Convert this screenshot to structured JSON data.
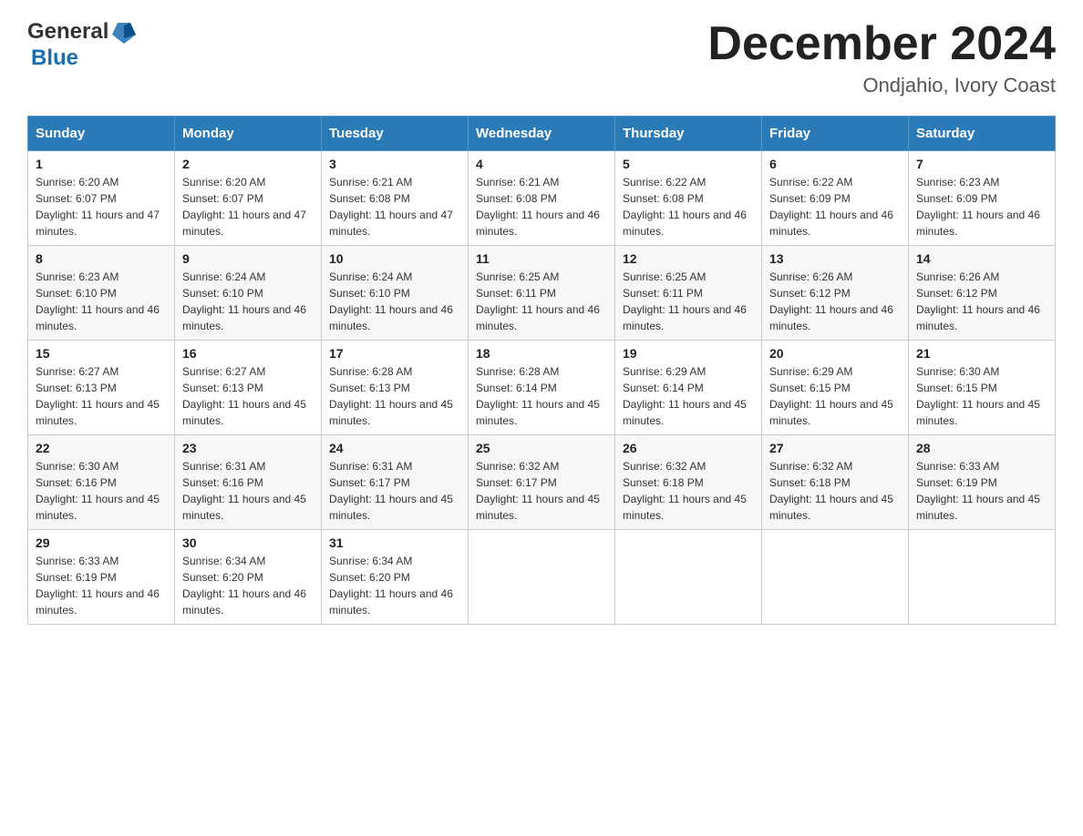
{
  "header": {
    "logo": {
      "general": "General",
      "blue": "Blue"
    },
    "title": "December 2024",
    "subtitle": "Ondjahio, Ivory Coast"
  },
  "weekdays": [
    "Sunday",
    "Monday",
    "Tuesday",
    "Wednesday",
    "Thursday",
    "Friday",
    "Saturday"
  ],
  "weeks": [
    [
      {
        "day": "1",
        "sunrise": "6:20 AM",
        "sunset": "6:07 PM",
        "daylight": "11 hours and 47 minutes."
      },
      {
        "day": "2",
        "sunrise": "6:20 AM",
        "sunset": "6:07 PM",
        "daylight": "11 hours and 47 minutes."
      },
      {
        "day": "3",
        "sunrise": "6:21 AM",
        "sunset": "6:08 PM",
        "daylight": "11 hours and 47 minutes."
      },
      {
        "day": "4",
        "sunrise": "6:21 AM",
        "sunset": "6:08 PM",
        "daylight": "11 hours and 46 minutes."
      },
      {
        "day": "5",
        "sunrise": "6:22 AM",
        "sunset": "6:08 PM",
        "daylight": "11 hours and 46 minutes."
      },
      {
        "day": "6",
        "sunrise": "6:22 AM",
        "sunset": "6:09 PM",
        "daylight": "11 hours and 46 minutes."
      },
      {
        "day": "7",
        "sunrise": "6:23 AM",
        "sunset": "6:09 PM",
        "daylight": "11 hours and 46 minutes."
      }
    ],
    [
      {
        "day": "8",
        "sunrise": "6:23 AM",
        "sunset": "6:10 PM",
        "daylight": "11 hours and 46 minutes."
      },
      {
        "day": "9",
        "sunrise": "6:24 AM",
        "sunset": "6:10 PM",
        "daylight": "11 hours and 46 minutes."
      },
      {
        "day": "10",
        "sunrise": "6:24 AM",
        "sunset": "6:10 PM",
        "daylight": "11 hours and 46 minutes."
      },
      {
        "day": "11",
        "sunrise": "6:25 AM",
        "sunset": "6:11 PM",
        "daylight": "11 hours and 46 minutes."
      },
      {
        "day": "12",
        "sunrise": "6:25 AM",
        "sunset": "6:11 PM",
        "daylight": "11 hours and 46 minutes."
      },
      {
        "day": "13",
        "sunrise": "6:26 AM",
        "sunset": "6:12 PM",
        "daylight": "11 hours and 46 minutes."
      },
      {
        "day": "14",
        "sunrise": "6:26 AM",
        "sunset": "6:12 PM",
        "daylight": "11 hours and 46 minutes."
      }
    ],
    [
      {
        "day": "15",
        "sunrise": "6:27 AM",
        "sunset": "6:13 PM",
        "daylight": "11 hours and 45 minutes."
      },
      {
        "day": "16",
        "sunrise": "6:27 AM",
        "sunset": "6:13 PM",
        "daylight": "11 hours and 45 minutes."
      },
      {
        "day": "17",
        "sunrise": "6:28 AM",
        "sunset": "6:13 PM",
        "daylight": "11 hours and 45 minutes."
      },
      {
        "day": "18",
        "sunrise": "6:28 AM",
        "sunset": "6:14 PM",
        "daylight": "11 hours and 45 minutes."
      },
      {
        "day": "19",
        "sunrise": "6:29 AM",
        "sunset": "6:14 PM",
        "daylight": "11 hours and 45 minutes."
      },
      {
        "day": "20",
        "sunrise": "6:29 AM",
        "sunset": "6:15 PM",
        "daylight": "11 hours and 45 minutes."
      },
      {
        "day": "21",
        "sunrise": "6:30 AM",
        "sunset": "6:15 PM",
        "daylight": "11 hours and 45 minutes."
      }
    ],
    [
      {
        "day": "22",
        "sunrise": "6:30 AM",
        "sunset": "6:16 PM",
        "daylight": "11 hours and 45 minutes."
      },
      {
        "day": "23",
        "sunrise": "6:31 AM",
        "sunset": "6:16 PM",
        "daylight": "11 hours and 45 minutes."
      },
      {
        "day": "24",
        "sunrise": "6:31 AM",
        "sunset": "6:17 PM",
        "daylight": "11 hours and 45 minutes."
      },
      {
        "day": "25",
        "sunrise": "6:32 AM",
        "sunset": "6:17 PM",
        "daylight": "11 hours and 45 minutes."
      },
      {
        "day": "26",
        "sunrise": "6:32 AM",
        "sunset": "6:18 PM",
        "daylight": "11 hours and 45 minutes."
      },
      {
        "day": "27",
        "sunrise": "6:32 AM",
        "sunset": "6:18 PM",
        "daylight": "11 hours and 45 minutes."
      },
      {
        "day": "28",
        "sunrise": "6:33 AM",
        "sunset": "6:19 PM",
        "daylight": "11 hours and 45 minutes."
      }
    ],
    [
      {
        "day": "29",
        "sunrise": "6:33 AM",
        "sunset": "6:19 PM",
        "daylight": "11 hours and 46 minutes."
      },
      {
        "day": "30",
        "sunrise": "6:34 AM",
        "sunset": "6:20 PM",
        "daylight": "11 hours and 46 minutes."
      },
      {
        "day": "31",
        "sunrise": "6:34 AM",
        "sunset": "6:20 PM",
        "daylight": "11 hours and 46 minutes."
      },
      null,
      null,
      null,
      null
    ]
  ]
}
